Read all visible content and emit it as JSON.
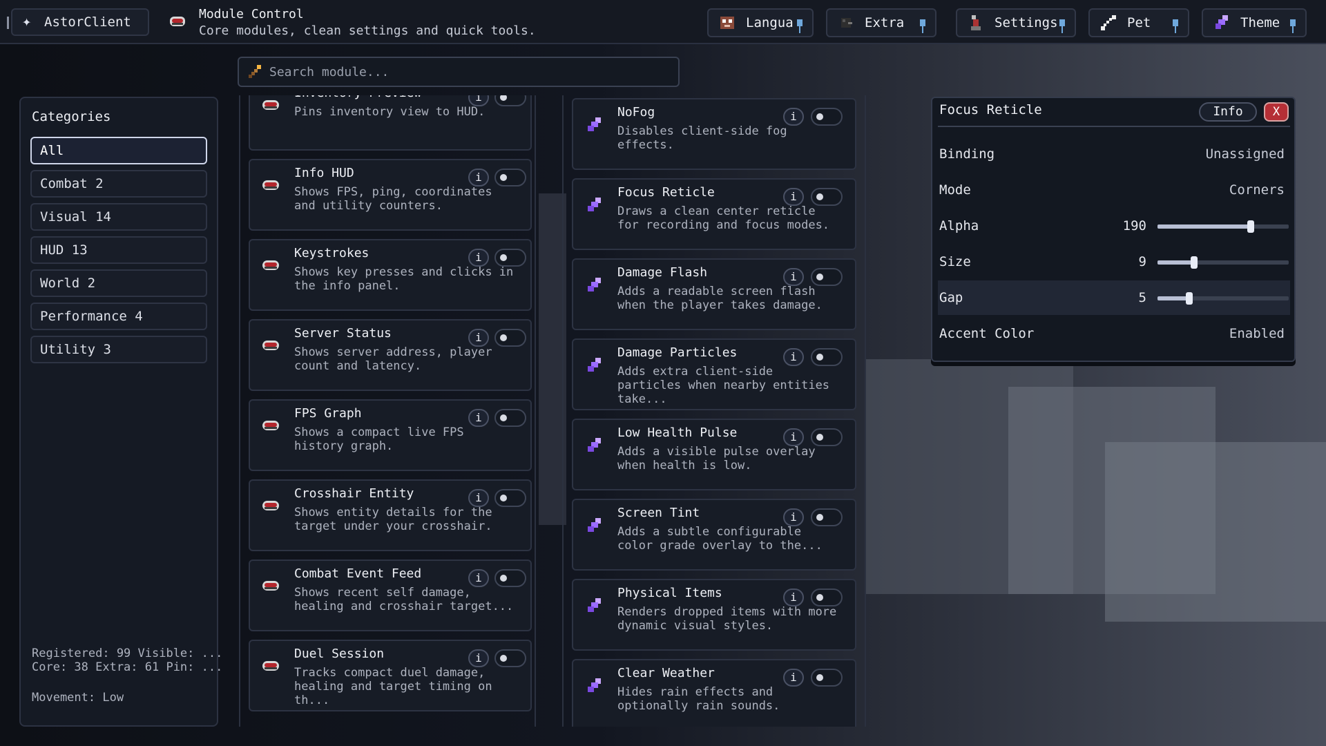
{
  "topbar": {
    "brand": "AstorClient",
    "title": "Module Control",
    "subtitle": "Core modules, clean settings and quick tools.",
    "buttons": [
      {
        "label": "Langua",
        "icon": "cat-face-icon"
      },
      {
        "label": "Extra",
        "icon": "bird-icon"
      },
      {
        "label": "Settings",
        "icon": "redstone-dust-icon"
      },
      {
        "label": "Pet",
        "icon": "bone-icon"
      },
      {
        "label": "Theme",
        "icon": "amethyst-shard-icon"
      }
    ]
  },
  "search": {
    "placeholder": "Search module..."
  },
  "categories": {
    "title": "Categories",
    "items": [
      {
        "label": "All"
      },
      {
        "label": "Combat  2"
      },
      {
        "label": "Visual  14"
      },
      {
        "label": "HUD  13"
      },
      {
        "label": "World  2"
      },
      {
        "label": "Performance  4"
      },
      {
        "label": "Utility  3"
      }
    ],
    "stats": [
      "Registered: 99 Visible: ...",
      "Core: 38 Extra: 61 Pin: ...",
      "Movement: Low"
    ]
  },
  "modules_left": [
    {
      "name": "Inventory Preview",
      "desc": "Pins inventory view to HUD."
    },
    {
      "name": "Info HUD",
      "desc": "Shows FPS, ping, coordinates and utility counters."
    },
    {
      "name": "Keystrokes",
      "desc": "Shows key presses and clicks in the info panel."
    },
    {
      "name": "Server Status",
      "desc": "Shows server address, player count and latency."
    },
    {
      "name": "FPS Graph",
      "desc": "Shows a compact live FPS history graph."
    },
    {
      "name": "Crosshair Entity",
      "desc": "Shows entity details for the target under your crosshair."
    },
    {
      "name": "Combat Event Feed",
      "desc": "Shows recent self damage, healing and crosshair target..."
    },
    {
      "name": "Duel Session",
      "desc": "Tracks compact duel damage, healing and target timing on th..."
    }
  ],
  "modules_right": [
    {
      "name": "NoFog",
      "desc": "Disables client-side fog effects."
    },
    {
      "name": "Focus Reticle",
      "desc": "Draws a clean center reticle for recording and focus modes."
    },
    {
      "name": "Damage Flash",
      "desc": "Adds a readable screen flash when the player takes damage."
    },
    {
      "name": "Damage Particles",
      "desc": "Adds extra client-side particles when nearby entities take..."
    },
    {
      "name": "Low Health Pulse",
      "desc": "Adds a visible pulse overlay when health is low."
    },
    {
      "name": "Screen Tint",
      "desc": "Adds a subtle configurable color grade overlay to the..."
    },
    {
      "name": "Physical Items",
      "desc": "Renders dropped items with more dynamic visual styles."
    },
    {
      "name": "Clear Weather",
      "desc": "Hides rain effects and optionally rain sounds."
    }
  ],
  "info_label": "i",
  "settings_panel": {
    "title": "Focus Reticle",
    "info_button": "Info",
    "close_button": "X",
    "binding": {
      "label": "Binding",
      "value": "Unassigned"
    },
    "mode": {
      "label": "Mode",
      "value": "Corners"
    },
    "alpha": {
      "label": "Alpha",
      "value": "190",
      "fraction": 0.71
    },
    "size": {
      "label": "Size",
      "value": "9",
      "fraction": 0.28
    },
    "gap": {
      "label": "Gap",
      "value": "5",
      "fraction": 0.24
    },
    "accent": {
      "label": "Accent Color",
      "value": "Enabled"
    }
  }
}
